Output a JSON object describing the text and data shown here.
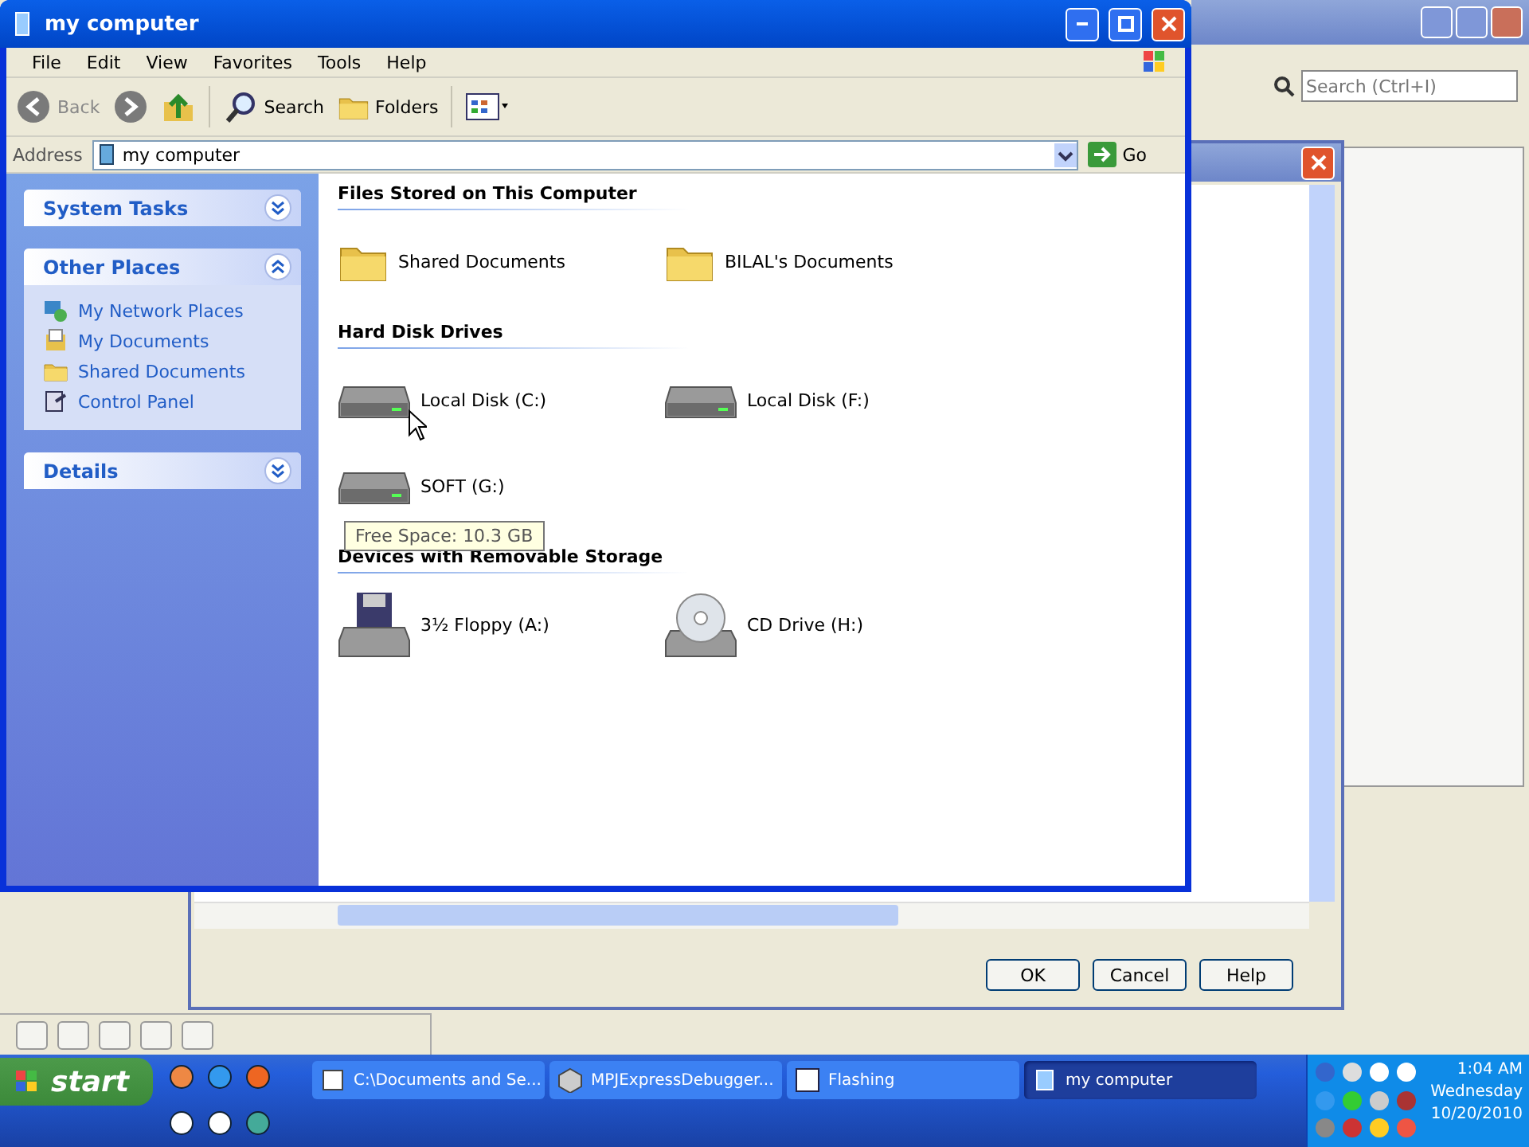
{
  "background_app": {
    "search": {
      "placeholder": "Search (Ctrl+I)"
    }
  },
  "dialog": {
    "buttons": [
      "OK",
      "Cancel",
      "Help"
    ]
  },
  "explorer": {
    "title": "my computer",
    "menu": [
      "File",
      "Edit",
      "View",
      "Favorites",
      "Tools",
      "Help"
    ],
    "toolbar": [
      {
        "kind": "back",
        "label": "Back"
      },
      {
        "kind": "forward"
      },
      {
        "kind": "up"
      },
      {
        "kind": "search",
        "label": "Search"
      },
      {
        "kind": "folders",
        "label": "Folders"
      },
      {
        "kind": "views"
      }
    ],
    "address": {
      "label": "Address",
      "value": "my computer",
      "go": "Go"
    },
    "sidebar": [
      {
        "title": "System Tasks",
        "expanded": false
      },
      {
        "title": "Other Places",
        "expanded": true,
        "items": [
          {
            "label": "My Network Places",
            "kind": "network"
          },
          {
            "label": "My Documents",
            "kind": "documents"
          },
          {
            "label": "Shared Documents",
            "kind": "folder"
          },
          {
            "label": "Control Panel",
            "kind": "control"
          }
        ]
      },
      {
        "title": "Details",
        "expanded": false
      }
    ],
    "sections": [
      {
        "heading": "Files Stored on This Computer",
        "items": [
          {
            "label": "Shared Documents",
            "kind": "folder"
          },
          {
            "label": "BILAL's Documents",
            "kind": "folder"
          }
        ]
      },
      {
        "heading": "Hard Disk Drives",
        "items": [
          {
            "label": "Local Disk (C:)",
            "kind": "disk"
          },
          {
            "label": "Local Disk (F:)",
            "kind": "disk"
          },
          {
            "label": "SOFT (G:)",
            "kind": "disk"
          }
        ]
      },
      {
        "heading": "Devices with Removable Storage",
        "items": [
          {
            "label": "3½ Floppy (A:)",
            "kind": "floppy"
          },
          {
            "label": "CD Drive (H:)",
            "kind": "cd"
          }
        ]
      }
    ],
    "tooltip": "Free Space: 10.3 GB"
  },
  "taskbar": {
    "start": "start",
    "tasks": [
      {
        "label": "C:\\Documents and Se...",
        "kind": "notepad",
        "selected": false
      },
      {
        "label": "MPJExpressDebugger...",
        "kind": "box",
        "selected": false
      },
      {
        "label": "Flashing",
        "kind": "window",
        "selected": false
      },
      {
        "label": "my computer",
        "kind": "computer",
        "selected": true
      }
    ],
    "clock": {
      "time": "1:04 AM",
      "day": "Wednesday",
      "date": "10/20/2010"
    }
  }
}
